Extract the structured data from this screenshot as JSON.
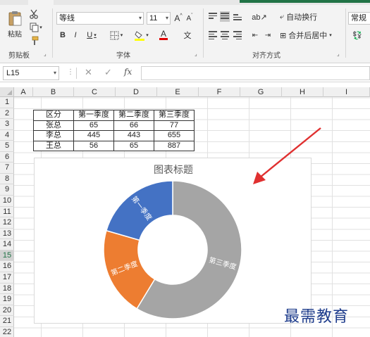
{
  "ribbon": {
    "clipboard": {
      "paste_label": "粘贴",
      "group_label": "剪贴板"
    },
    "font": {
      "font_name": "等线",
      "font_size": "11",
      "grow_label": "A",
      "shrink_label": "A",
      "bold_label": "B",
      "italic_label": "I",
      "underline_label": "U",
      "font_color_label": "A",
      "group_label": "字体"
    },
    "alignment": {
      "wrap_label": "自动换行",
      "merge_label": "合并后居中",
      "group_label": "对齐方式"
    },
    "number": {
      "format_label": "常规"
    }
  },
  "formula_bar": {
    "name_box": "L15",
    "fx_label": "fx"
  },
  "sheet": {
    "columns": [
      "A",
      "B",
      "C",
      "D",
      "E",
      "F",
      "G",
      "H",
      "I"
    ],
    "rows": [
      "1",
      "2",
      "3",
      "4",
      "5",
      "6",
      "7",
      "8",
      "9",
      "10",
      "11",
      "12",
      "13",
      "14",
      "15",
      "16",
      "17",
      "18",
      "19",
      "20",
      "21",
      "22"
    ],
    "table": {
      "header": [
        "区分",
        "第一季度",
        "第二季度",
        "第三季度"
      ],
      "rows": [
        [
          "张总",
          "65",
          "66",
          "77"
        ],
        [
          "李总",
          "445",
          "443",
          "655"
        ],
        [
          "王总",
          "56",
          "65",
          "887"
        ]
      ]
    }
  },
  "chart_data": {
    "type": "pie",
    "subtype": "doughnut",
    "title": "图表标题",
    "categories": [
      "第一季度",
      "第二季度",
      "第三季度"
    ],
    "values": [
      566,
      574,
      1619
    ],
    "colors": [
      "#4472c4",
      "#ed7d31",
      "#a5a5a5"
    ]
  },
  "watermark": "最需教育",
  "colors": {
    "excel_green": "#217346",
    "annotation_red": "#e03030"
  }
}
